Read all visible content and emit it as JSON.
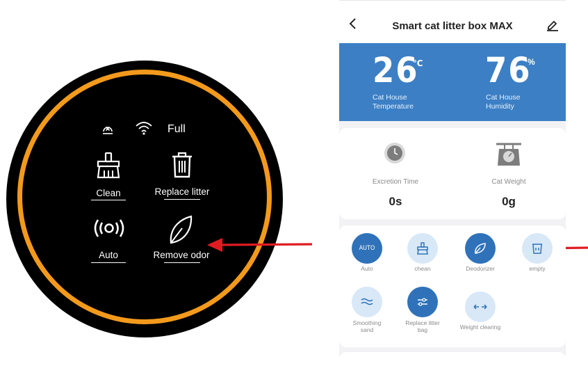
{
  "device_panel": {
    "status_text": "Full",
    "buttons": [
      {
        "label": "Clean",
        "icon": "broom-icon"
      },
      {
        "label": "Replace litter",
        "icon": "trash-can-icon"
      },
      {
        "label": "Auto",
        "icon": "broadcast-icon"
      },
      {
        "label": "Remove odor",
        "icon": "leaf-icon"
      }
    ],
    "ring_color": "#f39a1c"
  },
  "app": {
    "title": "Smart cat litter box MAX",
    "environment": {
      "temperature": {
        "value": "26",
        "unit": "℃",
        "label_line1": "Cat House",
        "label_line2": "Temperature"
      },
      "humidity": {
        "value": "76",
        "unit": "%",
        "label_line1": "Cat House",
        "label_line2": "Humidity"
      },
      "card_color": "#3c7fc4"
    },
    "stats": {
      "excretion": {
        "label": "Excretion Time",
        "value": "0s"
      },
      "weight": {
        "label": "Cat Weight",
        "value": "0g"
      }
    },
    "modes": {
      "auto": {
        "icon_text": "AUTO",
        "label": "Auto",
        "active": true
      },
      "clean": {
        "label": "chean",
        "active": false
      },
      "deodorizer": {
        "label": "Deodorizer",
        "active": true
      },
      "empty": {
        "label": "empty",
        "active": false
      },
      "smoothing": {
        "label_line1": "Smoothing",
        "label_line2": "sand",
        "active": false
      },
      "replace_bag": {
        "label_line1": "Replace litter",
        "label_line2": "bag",
        "active": true
      },
      "weight_clearing": {
        "label": "Weight clearing",
        "active": false
      }
    },
    "accent_color": "#2f72b9"
  },
  "annotations": {
    "arrow_color": "#e01b22"
  }
}
